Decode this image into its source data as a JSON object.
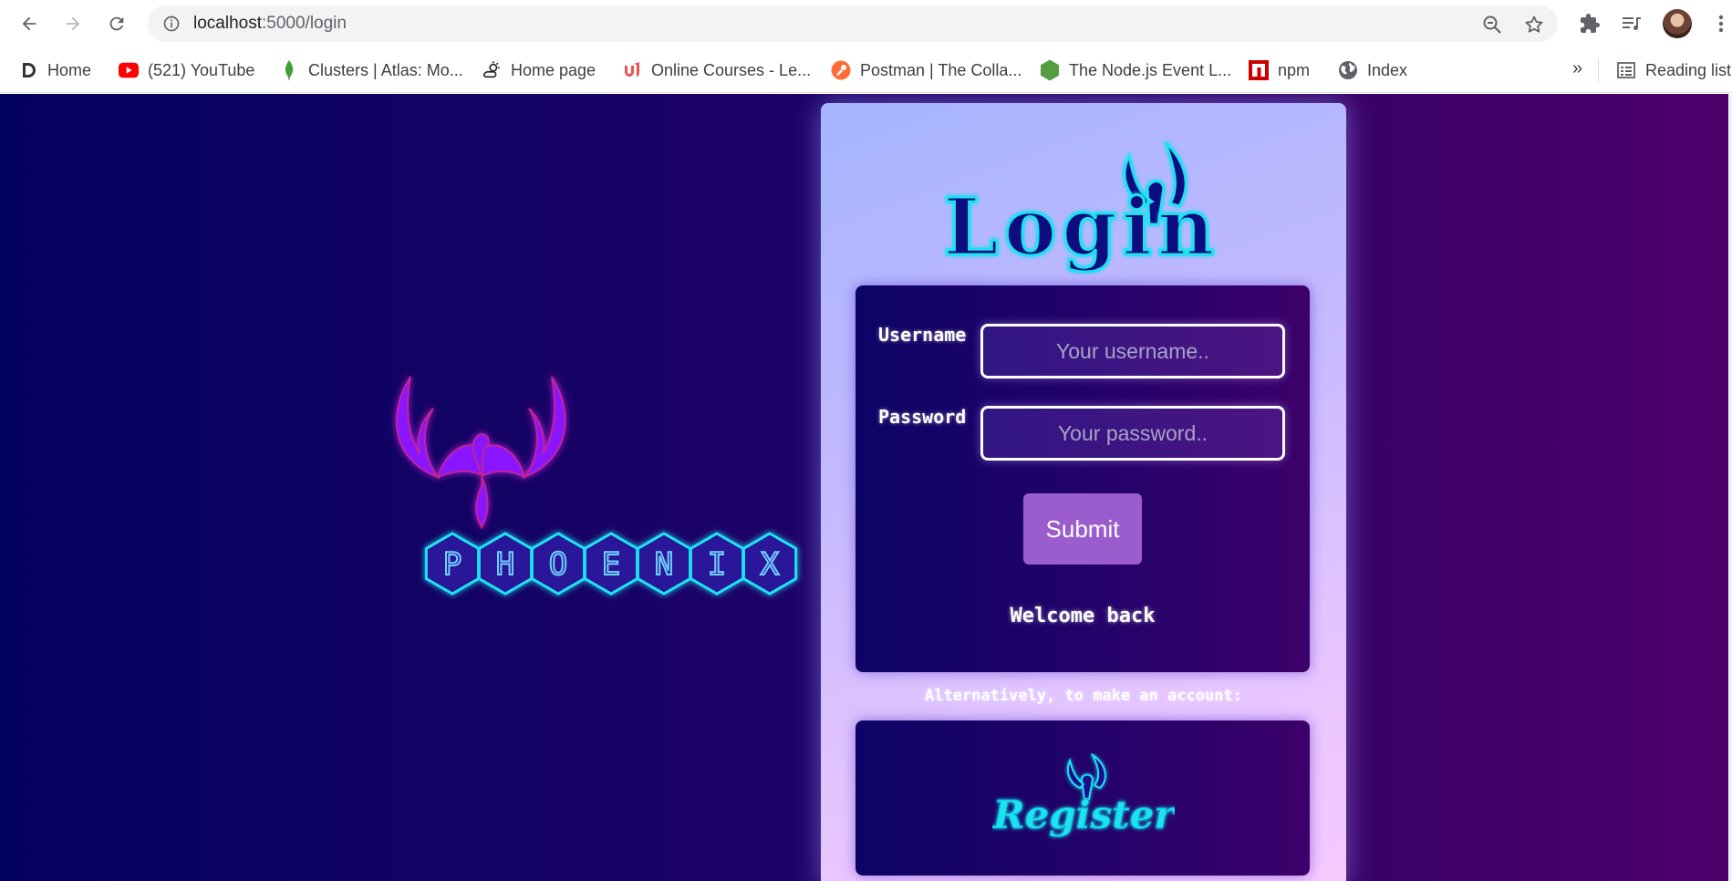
{
  "browser": {
    "url_host": "localhost",
    "url_path": ":5000/login",
    "bookmarks": [
      {
        "label": "Home",
        "icon": "dashlane-icon"
      },
      {
        "label": "(521) YouTube",
        "icon": "youtube-icon"
      },
      {
        "label": "Clusters | Atlas: Mo...",
        "icon": "mongodb-leaf-icon"
      },
      {
        "label": "Home page",
        "icon": "weather-icon"
      },
      {
        "label": "Online Courses - Le...",
        "icon": "udemy-icon"
      },
      {
        "label": "Postman | The Colla...",
        "icon": "postman-icon"
      },
      {
        "label": "The Node.js Event L...",
        "icon": "nodejs-icon"
      },
      {
        "label": "npm",
        "icon": "npm-icon"
      },
      {
        "label": "Index",
        "icon": "globe-icon"
      }
    ],
    "overflow": "»",
    "reading_list": "Reading list"
  },
  "page": {
    "logo_text": "PHOENIX",
    "title": "Login",
    "username_label": "Username",
    "username_placeholder": "Your username..",
    "password_label": "Password",
    "password_placeholder": "Your password..",
    "submit_label": "Submit",
    "welcome_text": "Welcome back",
    "alt_text": "Alternatively, to make an account:",
    "register_text": "Register"
  },
  "colors": {
    "accent_purple": "#9b5ccd",
    "neon_cyan": "#1ee3f2",
    "neon_violet": "#8a18ff",
    "bg_navy": "#04025f"
  }
}
